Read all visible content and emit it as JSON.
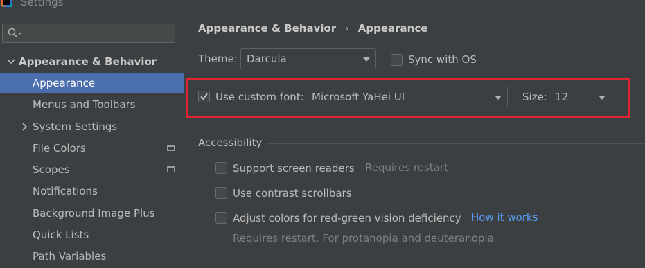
{
  "window": {
    "title": "Settings"
  },
  "search": {
    "placeholder": "",
    "value": ""
  },
  "sidebar": {
    "items": [
      {
        "label": "Appearance & Behavior",
        "level": 0,
        "expanded": true
      },
      {
        "label": "Appearance",
        "level": 1,
        "selected": true
      },
      {
        "label": "Menus and Toolbars",
        "level": 1
      },
      {
        "label": "System Settings",
        "level": 1,
        "collapsed": true
      },
      {
        "label": "File Colors",
        "level": 1,
        "badge_icon": "project-scope-icon"
      },
      {
        "label": "Scopes",
        "level": 1,
        "badge_icon": "project-scope-icon"
      },
      {
        "label": "Notifications",
        "level": 1
      },
      {
        "label": "Background Image Plus",
        "level": 1
      },
      {
        "label": "Quick Lists",
        "level": 1
      },
      {
        "label": "Path Variables",
        "level": 1
      }
    ]
  },
  "breadcrumb": {
    "parent": "Appearance & Behavior",
    "separator": "›",
    "current": "Appearance"
  },
  "theme": {
    "label": "Theme:",
    "value": "Darcula",
    "sync_label": "Sync with OS",
    "sync_checked": false
  },
  "font": {
    "use_custom_label": "Use custom font:",
    "use_custom_checked": true,
    "font_value": "Microsoft YaHei UI",
    "size_label": "Size:",
    "size_value": "12"
  },
  "accessibility": {
    "heading": "Accessibility",
    "screen_readers_label": "Support screen readers",
    "screen_readers_hint": "Requires restart",
    "contrast_scrollbars_label": "Use contrast scrollbars",
    "red_green_label": "Adjust colors for red-green vision deficiency",
    "red_green_link": "How it works",
    "red_green_hint": "Requires restart. For protanopia and deuteranopia"
  },
  "colors": {
    "background": "#3c3f41",
    "selection": "#4b6eaf",
    "highlight_box": "#e2222e",
    "link": "#589df6"
  }
}
